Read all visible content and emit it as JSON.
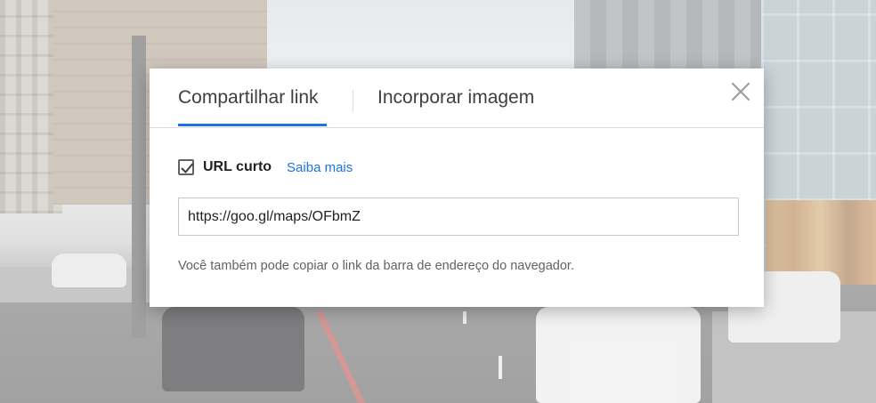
{
  "dialog": {
    "tabs": [
      {
        "label": "Compartilhar link",
        "active": true
      },
      {
        "label": "Incorporar imagem",
        "active": false
      }
    ],
    "close_icon": "close-icon",
    "short_url": {
      "checked": true,
      "label": "URL curto",
      "learn_more": "Saiba mais"
    },
    "url_value": "https://goo.gl/maps/OFbmZ",
    "hint": "Você também pode copiar o link da barra de endereço do navegador."
  },
  "colors": {
    "accent": "#1a73e8",
    "text": "#3c4043",
    "muted": "#5f6368"
  }
}
